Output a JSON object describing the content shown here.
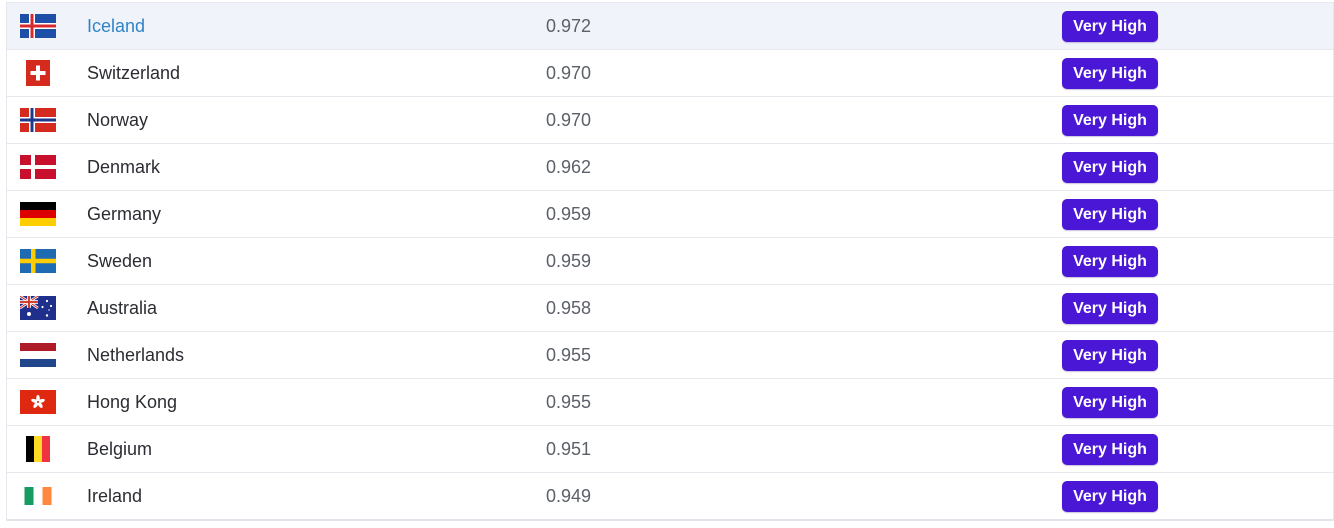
{
  "colors": {
    "badge_bg": "#4a17d6",
    "badge_text": "#ffffff",
    "link": "#2e84c6",
    "highlight_row": "#f1f3fb",
    "text": "#2b2d33",
    "score_text": "#5b6069"
  },
  "rows": [
    {
      "flag": "iceland-flag-icon",
      "country": "Iceland",
      "score": "0.972",
      "category": "Very High",
      "highlighted": true
    },
    {
      "flag": "switzerland-flag-icon",
      "country": "Switzerland",
      "score": "0.970",
      "category": "Very High"
    },
    {
      "flag": "norway-flag-icon",
      "country": "Norway",
      "score": "0.970",
      "category": "Very High"
    },
    {
      "flag": "denmark-flag-icon",
      "country": "Denmark",
      "score": "0.962",
      "category": "Very High"
    },
    {
      "flag": "germany-flag-icon",
      "country": "Germany",
      "score": "0.959",
      "category": "Very High"
    },
    {
      "flag": "sweden-flag-icon",
      "country": "Sweden",
      "score": "0.959",
      "category": "Very High"
    },
    {
      "flag": "australia-flag-icon",
      "country": "Australia",
      "score": "0.958",
      "category": "Very High"
    },
    {
      "flag": "netherlands-flag-icon",
      "country": "Netherlands",
      "score": "0.955",
      "category": "Very High"
    },
    {
      "flag": "hong-kong-flag-icon",
      "country": "Hong Kong",
      "score": "0.955",
      "category": "Very High"
    },
    {
      "flag": "belgium-flag-icon",
      "country": "Belgium",
      "score": "0.951",
      "category": "Very High"
    },
    {
      "flag": "ireland-flag-icon",
      "country": "Ireland",
      "score": "0.949",
      "category": "Very High"
    }
  ]
}
